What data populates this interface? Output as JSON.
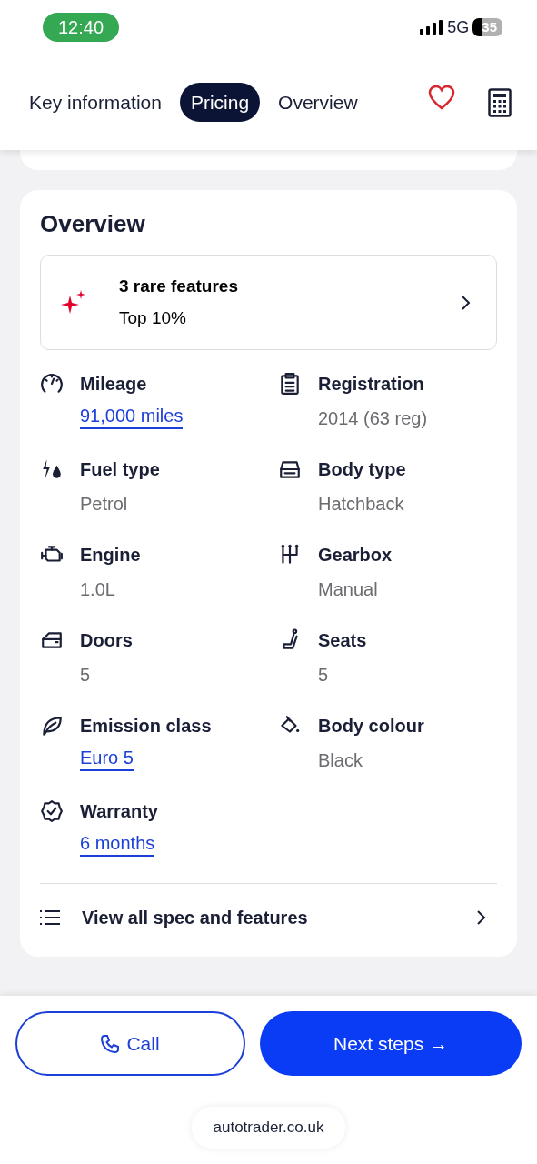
{
  "status_bar": {
    "time": "12:40",
    "network": "5G",
    "battery": "35"
  },
  "tabs": [
    {
      "label": "Key information",
      "selected": false
    },
    {
      "label": "Pricing",
      "selected": true
    },
    {
      "label": "Overview",
      "selected": false
    }
  ],
  "favourite": {
    "saved": false
  },
  "overview": {
    "title": "Overview",
    "rare_features": {
      "title": "3 rare features",
      "subtitle": "Top 10%"
    },
    "specs": [
      {
        "label": "Mileage",
        "value": "91,000 miles",
        "kind": "link"
      },
      {
        "label": "Registration",
        "value": "2014 (63 reg)",
        "kind": "text"
      },
      {
        "label": "Fuel type",
        "value": "Petrol",
        "kind": "text"
      },
      {
        "label": "Body type",
        "value": "Hatchback",
        "kind": "text"
      },
      {
        "label": "Engine",
        "value": "1.0L",
        "kind": "text"
      },
      {
        "label": "Gearbox",
        "value": "Manual",
        "kind": "text"
      },
      {
        "label": "Doors",
        "value": "5",
        "kind": "text"
      },
      {
        "label": "Seats",
        "value": "5",
        "kind": "text"
      },
      {
        "label": "Emission class",
        "value": "Euro 5",
        "kind": "link"
      },
      {
        "label": "Body colour",
        "value": "Black",
        "kind": "text"
      },
      {
        "label": "Warranty",
        "value": "6 months",
        "kind": "link"
      }
    ],
    "view_all": "View all spec and features"
  },
  "actions": {
    "call": "Call",
    "next": "Next steps →"
  },
  "url": "autotrader.co.uk"
}
